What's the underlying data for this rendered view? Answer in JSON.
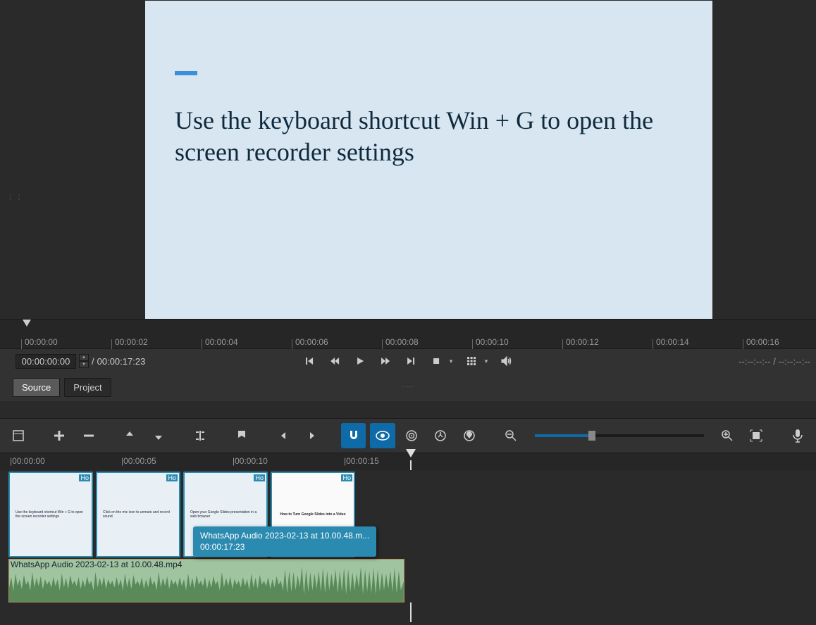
{
  "preview": {
    "slide_text": "Use the keyboard shortcut Win + G to open the screen recorder settings"
  },
  "ruler_top": {
    "ticks": [
      "00:00:00",
      "00:00:02",
      "00:00:04",
      "00:00:06",
      "00:00:08",
      "00:00:10",
      "00:00:12",
      "00:00:14",
      "00:00:16"
    ]
  },
  "player": {
    "current": "00:00:00:00",
    "total": "00:00:17:23",
    "in_out": "--:--:--:-- / --:--:--:--"
  },
  "tabs": {
    "source": "Source",
    "project": "Project"
  },
  "timeline_ruler": {
    "ticks": [
      "|00:00:00",
      "|00:00:05",
      "|00:00:10",
      "|00:00:15"
    ]
  },
  "clips": [
    {
      "label": "Ho",
      "thumb": "Use the keyboard shortcut Win + G to open the screen recorder settings"
    },
    {
      "label": "Ho",
      "thumb": "Click on the mic icon to unmute and record sound"
    },
    {
      "label": "Ho",
      "thumb": "Open your Google Slides presentation in a web browser"
    },
    {
      "label": "Ho",
      "title": "How to Turn Google Slides into a Video",
      "sub": ""
    }
  ],
  "tooltip": {
    "line1": "WhatsApp Audio 2023-02-13 at 10.00.48.m...",
    "line2": "00:00:17:23"
  },
  "audio": {
    "label": "WhatsApp Audio 2023-02-13 at 10.00.48.mp4"
  }
}
